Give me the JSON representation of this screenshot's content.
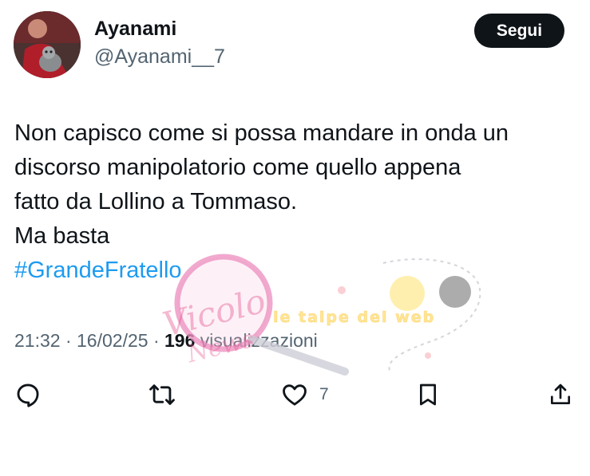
{
  "author": {
    "display_name": "Ayanami",
    "handle": "@Ayanami__7"
  },
  "follow_button_label": "Segui",
  "tweet": {
    "lines": [
      "Non capisco come si possa mandare in onda un",
      "discorso manipolatorio come quello appena",
      "fatto da Lollino a Tommaso.",
      "Ma basta"
    ],
    "hashtag": "#GrandeFratello"
  },
  "meta": {
    "time": "21:32",
    "separator": "·",
    "date": "16/02/25",
    "views_count": "196",
    "views_label": "visualizzazioni"
  },
  "actions": {
    "reply_icon": "reply-icon",
    "retweet_icon": "retweet-icon",
    "like_icon": "heart-icon",
    "like_count": "7",
    "bookmark_icon": "bookmark-icon",
    "share_icon": "share-icon"
  },
  "watermarks": {
    "left_text": "Vicolo delle News",
    "right_text": "le talpe del web"
  },
  "colors": {
    "text": "#0f1419",
    "secondary": "#536471",
    "link": "#1d9bf0",
    "button_bg": "#0f1419"
  }
}
